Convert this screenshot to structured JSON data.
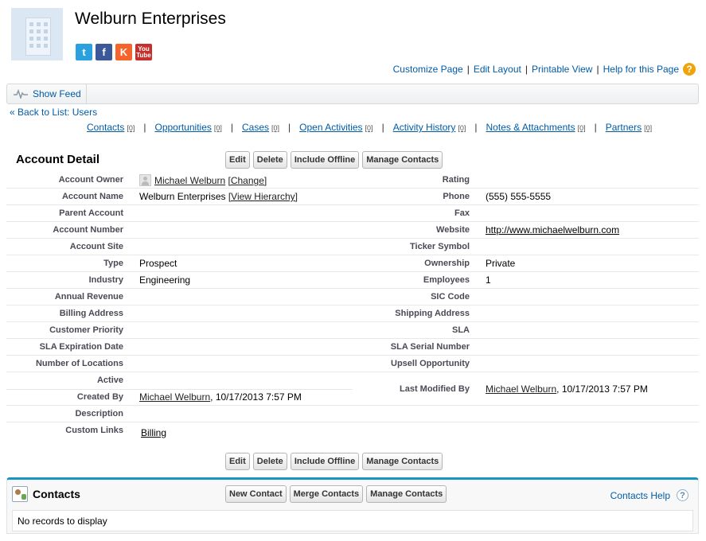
{
  "header": {
    "title": "Welburn Enterprises",
    "logo_icon": "building-icon",
    "social": [
      {
        "name": "twitter-icon",
        "glyph": "t",
        "color": "#2ba0de"
      },
      {
        "name": "facebook-icon",
        "glyph": "f",
        "color": "#3b5998"
      },
      {
        "name": "klout-icon",
        "glyph": "K",
        "color": "#f5642b"
      },
      {
        "name": "youtube-icon",
        "glyph_top": "You",
        "glyph_bottom": "Tube",
        "color": "#c4302b"
      }
    ],
    "links": {
      "customize": "Customize Page",
      "edit_layout": "Edit Layout",
      "printable": "Printable View",
      "help": "Help for this Page",
      "sep": "|",
      "help_glyph": "?"
    }
  },
  "feed": {
    "show_feed": "Show Feed"
  },
  "back": {
    "prefix": "«",
    "label": "Back to List: Users"
  },
  "related": {
    "sep": "|",
    "items": [
      {
        "label": "Contacts",
        "count": "[0]"
      },
      {
        "label": "Opportunities",
        "count": "[0]"
      },
      {
        "label": "Cases",
        "count": "[0]"
      },
      {
        "label": "Open Activities",
        "count": "[0]"
      },
      {
        "label": "Activity History",
        "count": "[0]"
      },
      {
        "label": "Notes & Attachments",
        "count": "[0]"
      },
      {
        "label": "Partners",
        "count": "[0]"
      }
    ]
  },
  "detail": {
    "heading": "Account Detail",
    "buttons": {
      "edit": "Edit",
      "delete": "Delete",
      "include_offline": "Include Offline",
      "manage_contacts": "Manage Contacts"
    },
    "rows": [
      {
        "l1": "Account Owner",
        "l2": "Rating"
      },
      {
        "l1": "Account Name",
        "l2": "Phone"
      },
      {
        "l1": "Parent Account",
        "l2": "Fax"
      },
      {
        "l1": "Account Number",
        "l2": "Website"
      },
      {
        "l1": "Account Site",
        "l2": "Ticker Symbol"
      },
      {
        "l1": "Type",
        "l2": "Ownership"
      },
      {
        "l1": "Industry",
        "l2": "Employees"
      },
      {
        "l1": "Annual Revenue",
        "l2": "SIC Code"
      },
      {
        "l1": "Billing Address",
        "l2": "Shipping Address"
      },
      {
        "l1": "Customer Priority",
        "l2": "SLA"
      },
      {
        "l1": "SLA Expiration Date",
        "l2": "SLA Serial Number"
      },
      {
        "l1": "Number of Locations",
        "l2": "Upsell Opportunity"
      },
      {
        "l1": "Active",
        "l2": ""
      },
      {
        "l1": "Created By",
        "l2": "Last Modified By"
      },
      {
        "l1": "Description",
        "l2": ""
      },
      {
        "l1": "Custom Links",
        "l2": ""
      }
    ],
    "values": {
      "owner_name": "Michael Welburn",
      "owner_change": "[Change]",
      "account_name": "Welburn Enterprises",
      "view_hierarchy": "[View Hierarchy]",
      "phone": "(555) 555-5555",
      "website": "http://www.michaelwelburn.com",
      "type": "Prospect",
      "ownership": "Private",
      "industry": "Engineering",
      "employees": "1",
      "created_by_name": "Michael Welburn",
      "created_by_date": ", 10/17/2013 7:57 PM",
      "modified_by_name": "Michael Welburn",
      "modified_by_date": ", 10/17/2013 7:57 PM",
      "custom_link": "Billing"
    }
  },
  "contacts": {
    "title": "Contacts",
    "buttons": {
      "new": "New Contact",
      "merge": "Merge Contacts",
      "manage": "Manage Contacts"
    },
    "help": "Contacts Help",
    "help_glyph": "?",
    "empty": "No records to display"
  }
}
